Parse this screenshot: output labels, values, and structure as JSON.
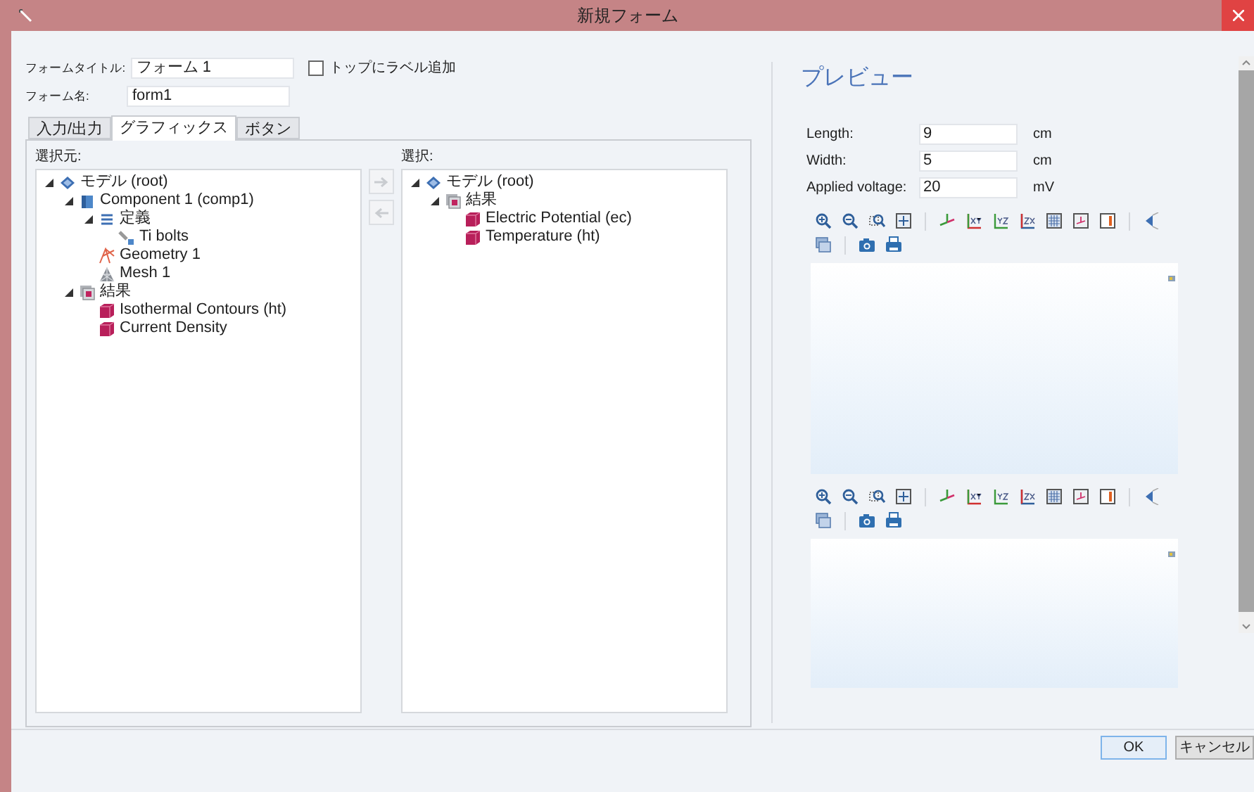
{
  "window": {
    "title": "新規フォーム"
  },
  "form_title": {
    "label": "フォームタイトル:",
    "value": "フォーム 1"
  },
  "add_label_on_top": {
    "label": "トップにラベル追加",
    "checked": false
  },
  "form_name": {
    "label": "フォーム名:",
    "value": "form1"
  },
  "tabs": [
    {
      "label": "入力/出力",
      "selected": false
    },
    {
      "label": "グラフィックス",
      "selected": true
    },
    {
      "label": "ボタン",
      "selected": false
    }
  ],
  "source": {
    "label": "選択元:",
    "tree": [
      {
        "kind": "model",
        "label": "モデル (root)",
        "expanded": true,
        "children": [
          {
            "kind": "component",
            "label": "Component 1 (comp1)",
            "expanded": true,
            "children": [
              {
                "kind": "definitions",
                "label": "定義",
                "expanded": true,
                "children": [
                  {
                    "kind": "variable",
                    "label": "Ti bolts"
                  }
                ]
              },
              {
                "kind": "geometry",
                "label": "Geometry 1"
              },
              {
                "kind": "mesh",
                "label": "Mesh 1"
              }
            ]
          },
          {
            "kind": "results",
            "label": "結果",
            "expanded": true,
            "children": [
              {
                "kind": "plot",
                "label": "Isothermal Contours (ht)"
              },
              {
                "kind": "plot",
                "label": "Current Density"
              }
            ]
          }
        ]
      }
    ]
  },
  "selection": {
    "label": "選択:",
    "tree": [
      {
        "kind": "model",
        "label": "モデル (root)",
        "expanded": true,
        "children": [
          {
            "kind": "results",
            "label": "結果",
            "expanded": true,
            "children": [
              {
                "kind": "plot",
                "label": "Electric Potential (ec)"
              },
              {
                "kind": "plot",
                "label": "Temperature (ht)"
              }
            ]
          }
        ]
      }
    ]
  },
  "preview": {
    "title": "プレビュー",
    "parameters": [
      {
        "label": "Length:",
        "value": "9",
        "unit": "cm"
      },
      {
        "label": "Width:",
        "value": "5",
        "unit": "cm"
      },
      {
        "label": "Applied voltage:",
        "value": "20",
        "unit": "mV"
      }
    ]
  },
  "buttons": [
    {
      "label": "OK",
      "kind": "default"
    },
    {
      "label": "キャンセル",
      "kind": "normal"
    }
  ]
}
